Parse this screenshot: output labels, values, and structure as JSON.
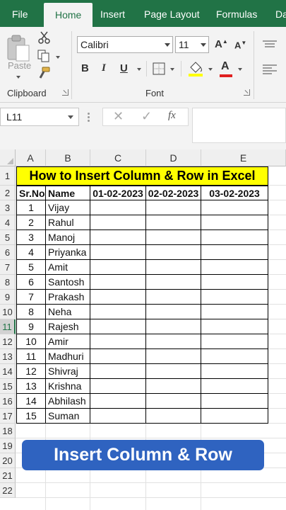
{
  "tabs": [
    "File",
    "Home",
    "Insert",
    "Page Layout",
    "Formulas",
    "Da"
  ],
  "active_tab": "Home",
  "clipboard": {
    "paste_label": "Paste",
    "group_label": "Clipboard"
  },
  "font": {
    "name": "Calibri",
    "size": "11",
    "group_label": "Font",
    "bold": "B",
    "italic": "I",
    "underline": "U",
    "grow": "A",
    "shrink": "A",
    "font_color_letter": "A",
    "font_color": "#e02020",
    "fill_color": "#ffff00"
  },
  "formula_bar": {
    "name_box": "L11",
    "fx": "fx",
    "value": ""
  },
  "columns": [
    "A",
    "B",
    "C",
    "D",
    "E"
  ],
  "rows": [
    "1",
    "2",
    "3",
    "4",
    "5",
    "6",
    "7",
    "8",
    "9",
    "10",
    "11",
    "12",
    "13",
    "14",
    "15",
    "16",
    "17",
    "18",
    "19",
    "20",
    "21",
    "22"
  ],
  "selected_row": "11",
  "sheet": {
    "title": "How to Insert Column & Row in Excel",
    "headers": [
      "Sr.No",
      "Name",
      "01-02-2023",
      "02-02-2023",
      "03-02-2023"
    ],
    "records": [
      [
        "1",
        "Vijay"
      ],
      [
        "2",
        "Rahul"
      ],
      [
        "3",
        "Manoj"
      ],
      [
        "4",
        "Priyanka"
      ],
      [
        "5",
        "Amit"
      ],
      [
        "6",
        "Santosh"
      ],
      [
        "7",
        "Prakash"
      ],
      [
        "8",
        "Neha"
      ],
      [
        "9",
        "Rajesh"
      ],
      [
        "10",
        "Amir"
      ],
      [
        "11",
        "Madhuri"
      ],
      [
        "12",
        "Shivraj"
      ],
      [
        "13",
        "Krishna"
      ],
      [
        "14",
        "Abhilash"
      ],
      [
        "15",
        "Suman"
      ]
    ]
  },
  "banner": "Insert Column & Row",
  "colors": {
    "excel_green": "#217346",
    "banner_blue": "#2f63c0",
    "title_fill": "#ffff00"
  }
}
